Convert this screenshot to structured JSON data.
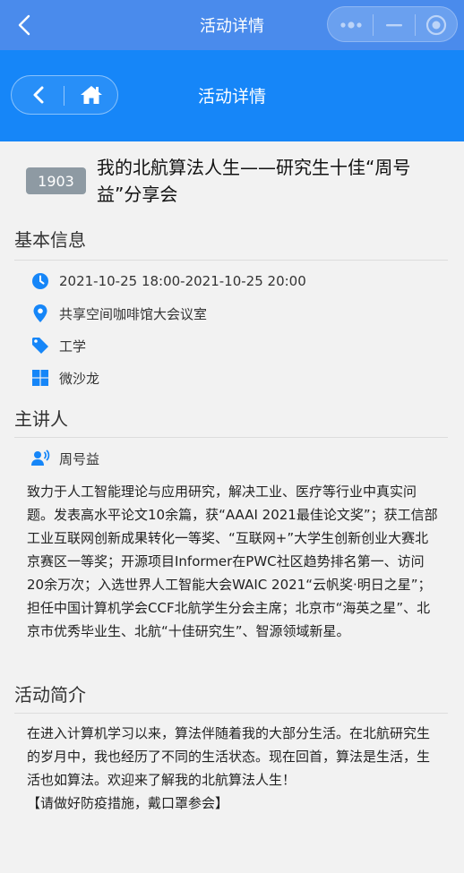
{
  "wechat_bar": {
    "title": "活动详情",
    "back_icon": "chevron-left-icon",
    "more_icon": "more-dots-icon",
    "minimize_icon": "minimize-icon",
    "close_icon": "target-close-icon"
  },
  "nav": {
    "title": "活动详情",
    "back_icon": "chevron-left-icon",
    "home_icon": "home-icon"
  },
  "event": {
    "id": "1903",
    "title": "我的北航算法人生——研究生十佳“周号益”分享会"
  },
  "basic_info": {
    "section_title": "基本信息",
    "time": "2021-10-25 18:00-2021-10-25 20:00",
    "location": "共享空间咖啡馆大会议室",
    "category": "工学",
    "format": "微沙龙"
  },
  "speaker": {
    "section_title": "主讲人",
    "name": "周号益",
    "bio": "致力于人工智能理论与应用研究，解决工业、医疗等行业中真实问题。发表高水平论文10余篇，获“AAAI 2021最佳论文奖”；获工信部工业互联网创新成果转化一等奖、“互联网+”大学生创新创业大赛北京赛区一等奖；开源项目Informer在PWC社区趋势排名第一、访问20余万次；入选世界人工智能大会WAIC 2021“云帆奖·明日之星”；担任中国计算机学会CCF北航学生分会主席；北京市“海英之星”、北京市优秀毕业生、北航“十佳研究生”、智源领域新星。"
  },
  "intro": {
    "section_title": "活动简介",
    "text": "在进入计算机学习以来，算法伴随着我的大部分生活。在北航研究生的岁月中，我也经历了不同的生活状态。现在回首，算法是生活，生活也如算法。欢迎来了解我的北航算法人生！",
    "note": "【请做好防疫措施，戴口罩参会】"
  },
  "colors": {
    "wechat_bar": "#4a8bec",
    "nav_bar": "#1686f8",
    "icon_blue": "#1686f8",
    "badge_gray": "#8e9aa3",
    "background": "#f2f2f2"
  }
}
